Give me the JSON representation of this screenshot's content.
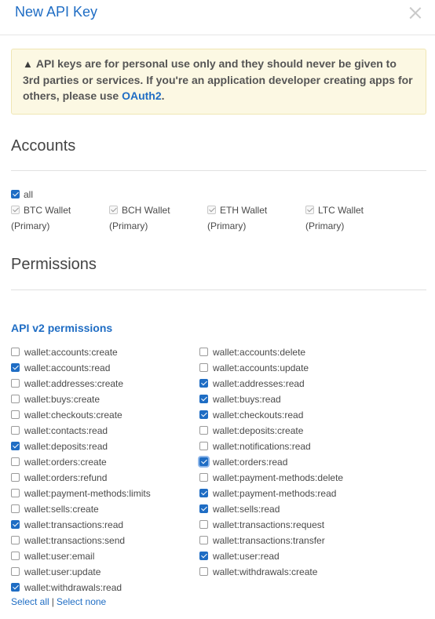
{
  "modal": {
    "title": "New API Key"
  },
  "warning": {
    "text": "API keys are for personal use only and they should never be given to 3rd parties or services. If you're an application developer creating apps for others, please use ",
    "link_text": "OAuth2",
    "end": "."
  },
  "accounts": {
    "heading": "Accounts",
    "all_label": "all",
    "all_checked": true,
    "items": [
      {
        "name": "BTC Wallet",
        "sub": "(Primary)",
        "checked": true
      },
      {
        "name": "BCH Wallet",
        "sub": "(Primary)",
        "checked": true
      },
      {
        "name": "ETH Wallet",
        "sub": "(Primary)",
        "checked": true
      },
      {
        "name": "LTC Wallet",
        "sub": "(Primary)",
        "checked": true
      }
    ]
  },
  "permissions": {
    "heading": "Permissions",
    "subheading": "API v2 permissions",
    "left": [
      {
        "label": "wallet:accounts:create",
        "checked": false
      },
      {
        "label": "wallet:accounts:read",
        "checked": true
      },
      {
        "label": "wallet:addresses:create",
        "checked": false
      },
      {
        "label": "wallet:buys:create",
        "checked": false
      },
      {
        "label": "wallet:checkouts:create",
        "checked": false
      },
      {
        "label": "wallet:contacts:read",
        "checked": false
      },
      {
        "label": "wallet:deposits:read",
        "checked": true
      },
      {
        "label": "wallet:orders:create",
        "checked": false
      },
      {
        "label": "wallet:orders:refund",
        "checked": false
      },
      {
        "label": "wallet:payment-methods:limits",
        "checked": false
      },
      {
        "label": "wallet:sells:create",
        "checked": false
      },
      {
        "label": "wallet:transactions:read",
        "checked": true
      },
      {
        "label": "wallet:transactions:send",
        "checked": false
      },
      {
        "label": "wallet:user:email",
        "checked": false
      },
      {
        "label": "wallet:user:update",
        "checked": false
      },
      {
        "label": "wallet:withdrawals:read",
        "checked": true
      }
    ],
    "right": [
      {
        "label": "wallet:accounts:delete",
        "checked": false
      },
      {
        "label": "wallet:accounts:update",
        "checked": false
      },
      {
        "label": "wallet:addresses:read",
        "checked": true
      },
      {
        "label": "wallet:buys:read",
        "checked": true
      },
      {
        "label": "wallet:checkouts:read",
        "checked": true
      },
      {
        "label": "wallet:deposits:create",
        "checked": false
      },
      {
        "label": "wallet:notifications:read",
        "checked": false
      },
      {
        "label": "wallet:orders:read",
        "checked": true,
        "focused": true
      },
      {
        "label": "wallet:payment-methods:delete",
        "checked": false
      },
      {
        "label": "wallet:payment-methods:read",
        "checked": true
      },
      {
        "label": "wallet:sells:read",
        "checked": true
      },
      {
        "label": "wallet:transactions:request",
        "checked": false
      },
      {
        "label": "wallet:transactions:transfer",
        "checked": false
      },
      {
        "label": "wallet:user:read",
        "checked": true
      },
      {
        "label": "wallet:withdrawals:create",
        "checked": false
      }
    ],
    "select_all": "Select all",
    "select_none": "Select none",
    "separator": "|"
  }
}
